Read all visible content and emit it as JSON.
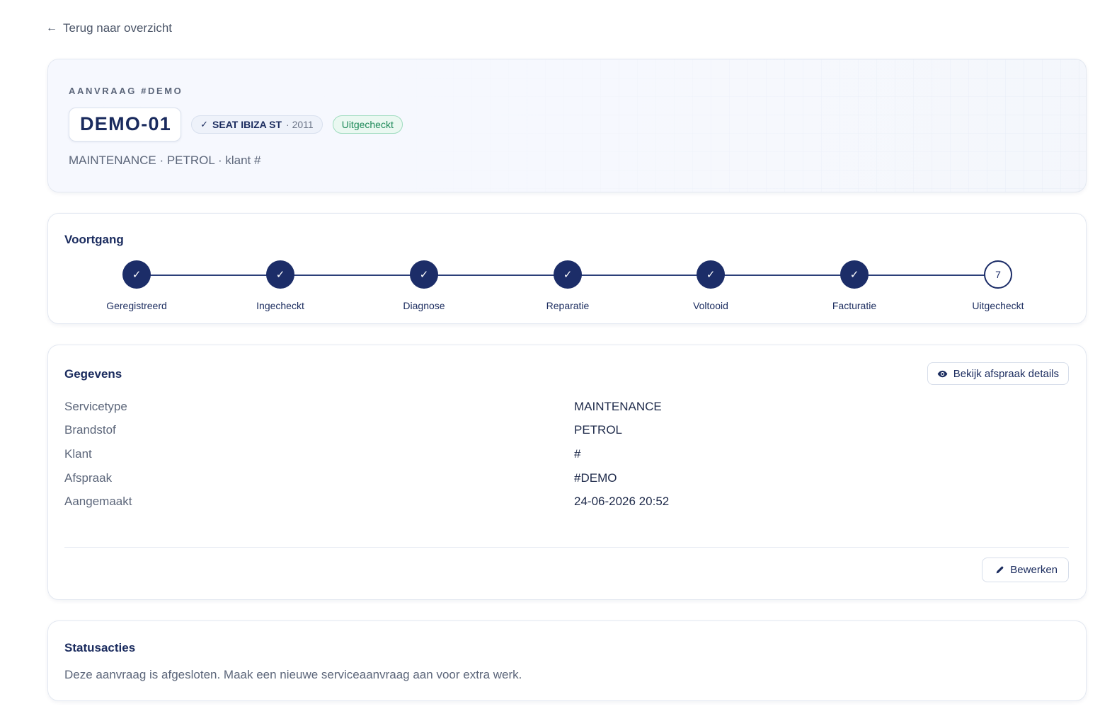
{
  "nav": {
    "back_arrow": "←",
    "back_label": "Terug naar overzicht"
  },
  "header": {
    "eyebrow": "AANVRAAG #DEMO",
    "request_id": "DEMO-01",
    "vehicle": {
      "check": "✓",
      "model": "SEAT IBIZA ST",
      "year": "· 2011"
    },
    "status_badge": "Uitgecheckt",
    "subline": "MAINTENANCE · PETROL · klant #"
  },
  "progress": {
    "title": "Voortgang",
    "completed_steps": 6,
    "total_steps": 7,
    "steps": [
      {
        "label": "Geregistreerd",
        "state": "done",
        "mark": "✓"
      },
      {
        "label": "Ingecheckt",
        "state": "done",
        "mark": "✓"
      },
      {
        "label": "Diagnose",
        "state": "done",
        "mark": "✓"
      },
      {
        "label": "Reparatie",
        "state": "done",
        "mark": "✓"
      },
      {
        "label": "Voltooid",
        "state": "done",
        "mark": "✓"
      },
      {
        "label": "Facturatie",
        "state": "done",
        "mark": "✓"
      },
      {
        "label": "Uitgecheckt",
        "state": "current",
        "mark": "7"
      }
    ]
  },
  "details": {
    "title": "Gegevens",
    "view_button": "Bekijk afspraak details",
    "edit_button": "Bewerken",
    "rows": [
      {
        "key": "Servicetype",
        "value": "MAINTENANCE"
      },
      {
        "key": "Brandstof",
        "value": "PETROL"
      },
      {
        "key": "Klant",
        "value": "#"
      },
      {
        "key": "Afspraak",
        "value": "#DEMO"
      },
      {
        "key": "Aangemaakt",
        "value": "24-06-2026 20:52"
      }
    ]
  },
  "status_actions": {
    "title": "Statusacties",
    "message": "Deze aanvraag is afgesloten. Maak een nieuwe serviceaanvraag aan voor extra werk."
  },
  "colors": {
    "primary": "#1c2d68",
    "success_text": "#1f8a5a",
    "success_bg": "#eaf8f1",
    "muted_text": "#5c667a",
    "border": "#e3e8f1"
  },
  "icons": {
    "back": "arrow-left-icon",
    "view": "eye-icon",
    "edit": "pencil-icon",
    "step_done": "check-icon"
  }
}
